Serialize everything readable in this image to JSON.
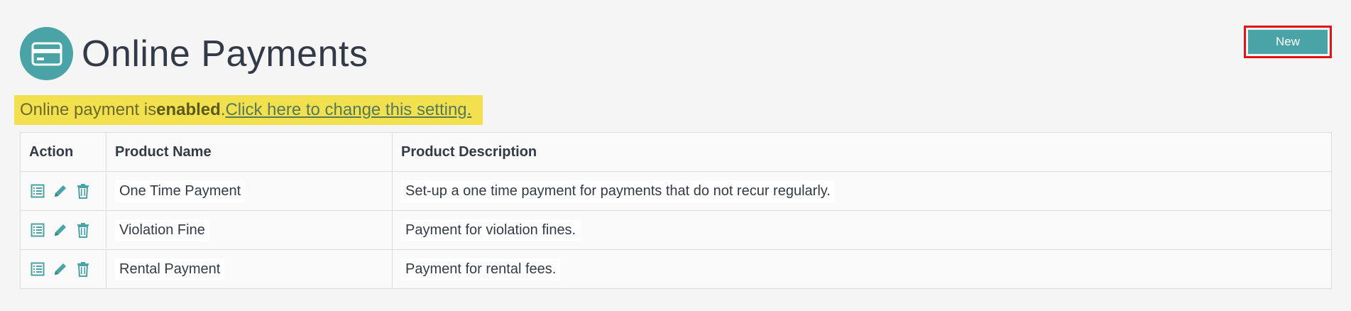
{
  "header": {
    "title": "Online Payments",
    "logo_icon": "credit-card-icon"
  },
  "toolbar": {
    "new_label": "New"
  },
  "notice": {
    "prefix": "Online payment is ",
    "status": "enabled",
    "separator": " .",
    "link_text": "Click here to change this setting."
  },
  "table": {
    "columns": [
      "Action",
      "Product Name",
      "Product Description"
    ],
    "rows": [
      {
        "name": "One Time Payment",
        "description": "Set-up a one time payment for payments that do not recur regularly."
      },
      {
        "name": "Violation Fine",
        "description": "Payment for violation fines."
      },
      {
        "name": "Rental Payment",
        "description": "Payment for rental fees."
      }
    ]
  },
  "colors": {
    "accent": "#4aa3a6",
    "notice_bg": "#f3e04f",
    "highlight_border": "#e01414"
  },
  "icons": [
    "list-icon",
    "pencil-icon",
    "trash-icon"
  ]
}
